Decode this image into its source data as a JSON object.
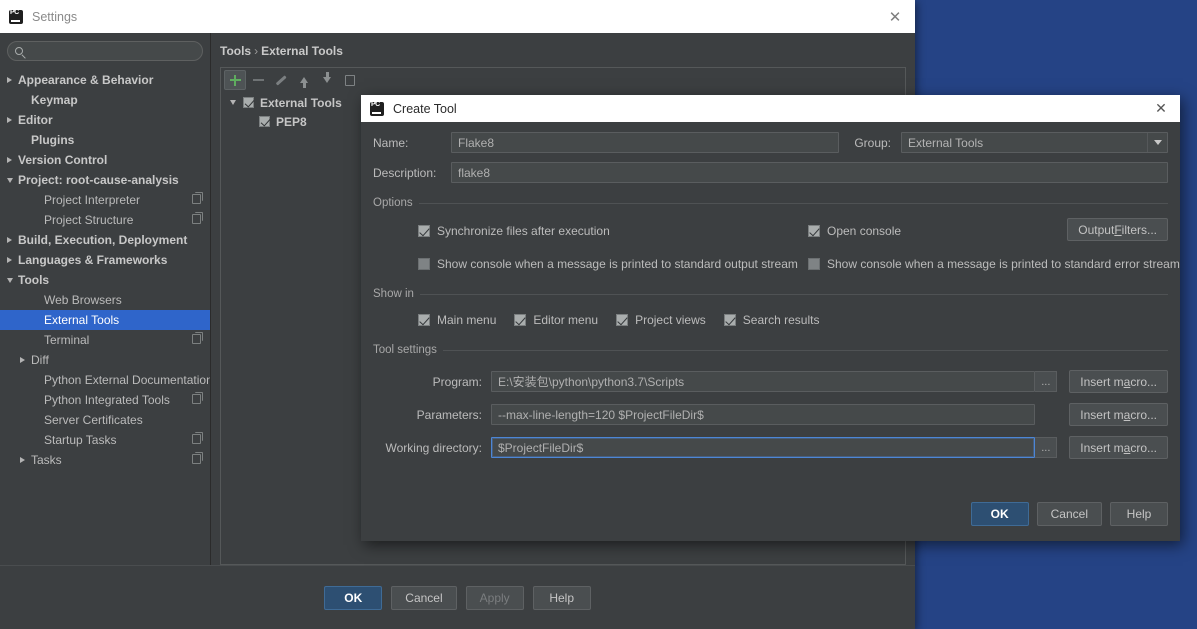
{
  "desktop": {
    "background_color": "#254385"
  },
  "settings_window": {
    "title": "Settings",
    "logo_icon": "pycharm-logo-icon",
    "close_icon": "close-icon",
    "search": {
      "value": "",
      "placeholder": "",
      "icon": "search-icon"
    },
    "tree": [
      {
        "label": "Appearance & Behavior",
        "twisty": "right",
        "bold": true,
        "indent": 0,
        "selected": false,
        "copy": false
      },
      {
        "label": "Keymap",
        "twisty": "none",
        "bold": true,
        "indent": 1,
        "selected": false,
        "copy": false
      },
      {
        "label": "Editor",
        "twisty": "right",
        "bold": true,
        "indent": 0,
        "selected": false,
        "copy": false
      },
      {
        "label": "Plugins",
        "twisty": "none",
        "bold": true,
        "indent": 1,
        "selected": false,
        "copy": false
      },
      {
        "label": "Version Control",
        "twisty": "right",
        "bold": true,
        "indent": 0,
        "selected": false,
        "copy": false
      },
      {
        "label": "Project: root-cause-analysis",
        "twisty": "down",
        "bold": true,
        "indent": 0,
        "selected": false,
        "copy": false
      },
      {
        "label": "Project Interpreter",
        "twisty": "none",
        "bold": false,
        "indent": 2,
        "selected": false,
        "copy": true
      },
      {
        "label": "Project Structure",
        "twisty": "none",
        "bold": false,
        "indent": 2,
        "selected": false,
        "copy": true
      },
      {
        "label": "Build, Execution, Deployment",
        "twisty": "right",
        "bold": true,
        "indent": 0,
        "selected": false,
        "copy": false
      },
      {
        "label": "Languages & Frameworks",
        "twisty": "right",
        "bold": true,
        "indent": 0,
        "selected": false,
        "copy": false
      },
      {
        "label": "Tools",
        "twisty": "down",
        "bold": true,
        "indent": 0,
        "selected": false,
        "copy": false
      },
      {
        "label": "Web Browsers",
        "twisty": "none",
        "bold": false,
        "indent": 2,
        "selected": false,
        "copy": false
      },
      {
        "label": "External Tools",
        "twisty": "none",
        "bold": false,
        "indent": 2,
        "selected": true,
        "copy": false
      },
      {
        "label": "Terminal",
        "twisty": "none",
        "bold": false,
        "indent": 2,
        "selected": false,
        "copy": true
      },
      {
        "label": "Diff",
        "twisty": "right",
        "bold": false,
        "indent": 1,
        "selected": false,
        "copy": false
      },
      {
        "label": "Python External Documentation",
        "twisty": "none",
        "bold": false,
        "indent": 2,
        "selected": false,
        "copy": false
      },
      {
        "label": "Python Integrated Tools",
        "twisty": "none",
        "bold": false,
        "indent": 2,
        "selected": false,
        "copy": true
      },
      {
        "label": "Server Certificates",
        "twisty": "none",
        "bold": false,
        "indent": 2,
        "selected": false,
        "copy": false
      },
      {
        "label": "Startup Tasks",
        "twisty": "none",
        "bold": false,
        "indent": 2,
        "selected": false,
        "copy": true
      },
      {
        "label": "Tasks",
        "twisty": "right",
        "bold": false,
        "indent": 1,
        "selected": false,
        "copy": true
      }
    ],
    "breadcrumb": {
      "parent": "Tools",
      "separator": "›",
      "current": "External Tools"
    },
    "tool_toolbar": [
      {
        "icon": "add-icon",
        "active": true
      },
      {
        "icon": "remove-icon",
        "active": false
      },
      {
        "icon": "edit-pencil-icon",
        "active": false
      },
      {
        "icon": "move-up-icon",
        "active": false
      },
      {
        "icon": "move-down-icon",
        "active": false
      },
      {
        "icon": "copy-icon",
        "active": false
      }
    ],
    "tool_tree": [
      {
        "label": "External Tools",
        "twisty": "down",
        "checked": true,
        "indent": 0
      },
      {
        "label": "PEP8",
        "twisty": "none",
        "checked": true,
        "indent": 1
      }
    ],
    "buttons": {
      "ok": "OK",
      "cancel": "Cancel",
      "apply": "Apply",
      "help": "Help"
    }
  },
  "create_tool_dialog": {
    "title": "Create Tool",
    "logo_icon": "pycharm-logo-icon",
    "close_icon": "close-icon",
    "name": {
      "label": "Name:",
      "value": "Flake8"
    },
    "group": {
      "label": "Group:",
      "value": "External Tools",
      "arrow_icon": "chevron-down-icon"
    },
    "description": {
      "label": "Description:",
      "value": "flake8"
    },
    "options": {
      "title": "Options",
      "checkboxes": [
        {
          "label": "Synchronize files after execution",
          "checked": true
        },
        {
          "label": "Open console",
          "checked": true
        },
        {
          "label": "Show console when a message is printed to standard output stream",
          "checked": false
        },
        {
          "label": "Show console when a message is printed to standard error stream",
          "checked": false
        }
      ],
      "output_filters_button": {
        "pre": "Output ",
        "mnemonic": "F",
        "post": "ilters..."
      }
    },
    "show_in": {
      "title": "Show in",
      "checkboxes": [
        {
          "label": "Main menu",
          "checked": true
        },
        {
          "label": "Editor menu",
          "checked": true
        },
        {
          "label": "Project views",
          "checked": true
        },
        {
          "label": "Search results",
          "checked": true
        }
      ]
    },
    "tool_settings": {
      "title": "Tool settings",
      "rows": [
        {
          "label": "Program:",
          "value": "E:\\安装包\\python\\python3.7\\Scripts",
          "focused": false,
          "browse": "...",
          "macro_pre": "Insert m",
          "macro_mnemonic": "a",
          "macro_post": "cro..."
        },
        {
          "label": "Parameters:",
          "value": "--max-line-length=120 $ProjectFileDir$",
          "focused": false,
          "browse": "",
          "macro_pre": "Insert m",
          "macro_mnemonic": "a",
          "macro_post": "cro..."
        },
        {
          "label": "Working directory:",
          "value": "$ProjectFileDir$",
          "focused": true,
          "browse": "...",
          "macro_pre": "Insert m",
          "macro_mnemonic": "a",
          "macro_post": "cro..."
        }
      ]
    },
    "buttons": {
      "ok": "OK",
      "cancel": "Cancel",
      "help": "Help"
    }
  }
}
